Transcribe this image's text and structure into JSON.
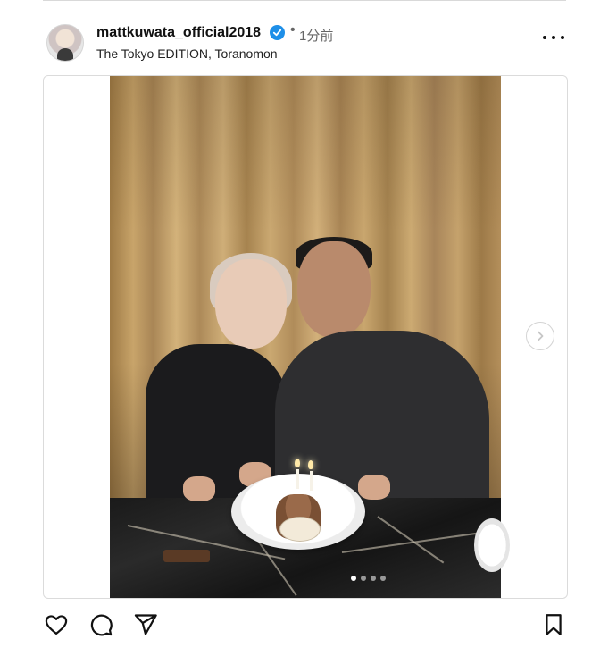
{
  "post": {
    "username": "mattkuwata_official2018",
    "separator": "•",
    "time": "1分前",
    "location": "The Tokyo EDITION, Toranomon"
  },
  "icons": {
    "avatar": "avatar",
    "verified": "verified-badge-icon",
    "more": "more-options-icon",
    "next": "chevron-right-icon",
    "like": "heart-icon",
    "comment": "comment-icon",
    "share": "send-icon",
    "save": "bookmark-icon"
  },
  "carousel": {
    "slide_count": 4,
    "active_index": 0
  },
  "colors": {
    "verified": "#1e8fe8",
    "text": "#111111",
    "muted": "#666666",
    "border": "#dbdbdb"
  }
}
